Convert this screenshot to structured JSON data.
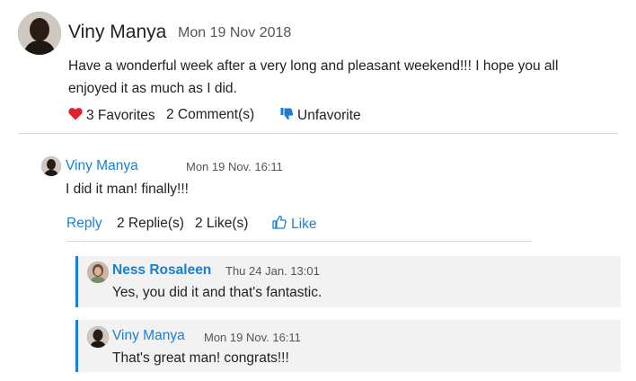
{
  "post": {
    "author": "Viny Manya",
    "date": "Mon 19 Nov 2018",
    "body": "Have a wonderful week after a very long and pleasant weekend!!! I hope you all enjoyed it as much as I did.",
    "favorites_label": "3 Favorites",
    "comments_label": "2 Comment(s)",
    "unfavorite_label": "Unfavorite"
  },
  "comment": {
    "author": "Viny Manya",
    "date": "Mon 19 Nov. 16:11",
    "body": "I did it man! finally!!!",
    "reply_label": "Reply",
    "replies_label": "2 Replie(s)",
    "likes_label": "2 Like(s)",
    "like_label": "Like"
  },
  "replies": [
    {
      "author": "Ness Rosaleen",
      "date": "Thu 24 Jan. 13:01",
      "body": "Yes, you did it and that's fantastic."
    },
    {
      "author": "Viny Manya",
      "date": "Mon 19 Nov. 16:11",
      "body": "That's great man! congrats!!!"
    }
  ],
  "colors": {
    "accent": "#1a7fd4",
    "heart": "#e0202a",
    "reply_bg": "#f2f2f2"
  }
}
